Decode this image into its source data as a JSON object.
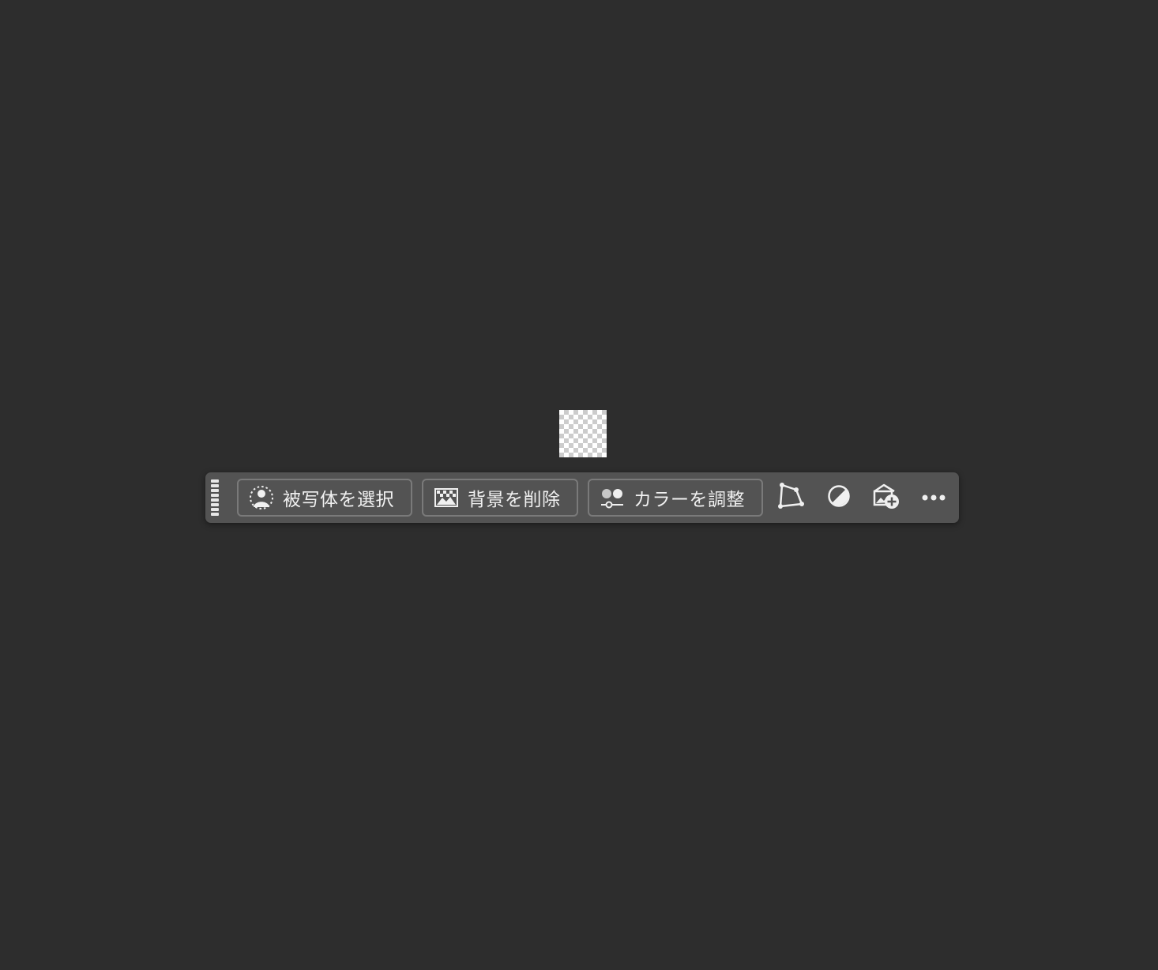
{
  "app": {
    "background_color": "#2d2d2d"
  },
  "canvas": {
    "document_fill": "transparent-checkerboard"
  },
  "taskbar": {
    "background_color": "#535353",
    "buttons": [
      {
        "label": "被写体を選択",
        "icon": "select-subject-icon"
      },
      {
        "label": "背景を削除",
        "icon": "remove-background-icon"
      },
      {
        "label": "カラーを調整",
        "icon": "adjust-color-icon"
      }
    ],
    "icon_buttons": [
      {
        "icon": "transform-path-icon"
      },
      {
        "icon": "contrast-icon"
      },
      {
        "icon": "add-image-icon"
      },
      {
        "icon": "more-options-icon"
      }
    ]
  }
}
